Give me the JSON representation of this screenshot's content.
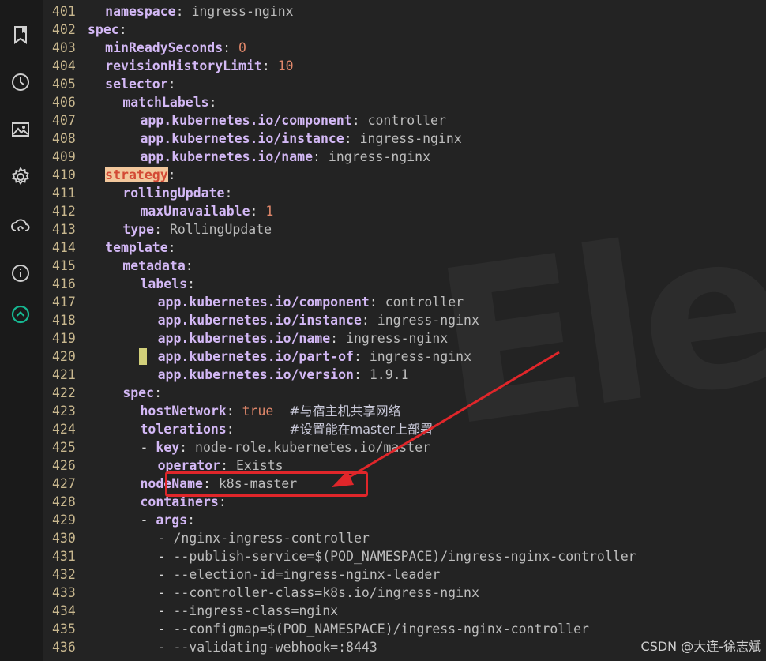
{
  "sidebar": {
    "icons": [
      "bookmark-icon",
      "clock-icon",
      "image-icon",
      "gear-icon",
      "cloud-sync-icon",
      "info-icon",
      "scroll-up-icon"
    ]
  },
  "watermark_text": "Elec",
  "editor": {
    "lines": [
      {
        "n": "401",
        "indent": 1,
        "key": "namespace",
        "val": "ingress-nginx"
      },
      {
        "n": "402",
        "indent": 0,
        "key": "spec"
      },
      {
        "n": "403",
        "indent": 1,
        "key": "minReadySeconds",
        "val": "0",
        "vt": "num"
      },
      {
        "n": "404",
        "indent": 1,
        "key": "revisionHistoryLimit",
        "val": "10",
        "vt": "num"
      },
      {
        "n": "405",
        "indent": 1,
        "key": "selector"
      },
      {
        "n": "406",
        "indent": 2,
        "key": "matchLabels"
      },
      {
        "n": "407",
        "indent": 3,
        "key": "app.kubernetes.io/component",
        "val": "controller"
      },
      {
        "n": "408",
        "indent": 3,
        "key": "app.kubernetes.io/instance",
        "val": "ingress-nginx"
      },
      {
        "n": "409",
        "indent": 3,
        "key": "app.kubernetes.io/name",
        "val": "ingress-nginx"
      },
      {
        "n": "410",
        "indent": 1,
        "key": "strategy",
        "hl": true
      },
      {
        "n": "411",
        "indent": 2,
        "key": "rollingUpdate"
      },
      {
        "n": "412",
        "indent": 3,
        "key": "maxUnavailable",
        "val": "1",
        "vt": "num"
      },
      {
        "n": "413",
        "indent": 2,
        "key": "type",
        "val": "RollingUpdate"
      },
      {
        "n": "414",
        "indent": 1,
        "key": "template"
      },
      {
        "n": "415",
        "indent": 2,
        "key": "metadata"
      },
      {
        "n": "416",
        "indent": 3,
        "key": "labels"
      },
      {
        "n": "417",
        "indent": 4,
        "key": "app.kubernetes.io/component",
        "val": "controller"
      },
      {
        "n": "418",
        "indent": 4,
        "key": "app.kubernetes.io/instance",
        "val": "ingress-nginx"
      },
      {
        "n": "419",
        "indent": 4,
        "key": "app.kubernetes.io/name",
        "val": "ingress-nginx"
      },
      {
        "n": "420",
        "indent": 4,
        "key": "app.kubernetes.io/part-of",
        "val": "ingress-nginx"
      },
      {
        "n": "421",
        "indent": 4,
        "key": "app.kubernetes.io/version",
        "val": "1.9.1"
      },
      {
        "n": "422",
        "indent": 2,
        "key": "spec"
      },
      {
        "n": "423",
        "indent": 3,
        "key": "hostNetwork",
        "val": "true",
        "vt": "bool",
        "pad": "  ",
        "comment": "#与宿主机共享网络"
      },
      {
        "n": "424",
        "indent": 3,
        "key": "tolerations",
        "pad": "       ",
        "comment": "#设置能在master上部署"
      },
      {
        "n": "425",
        "indent": 3,
        "dash": true,
        "key": "key",
        "val": "node-role.kubernetes.io/master"
      },
      {
        "n": "426",
        "indent": 4,
        "key": "operator",
        "val": "Exists"
      },
      {
        "n": "427",
        "indent": 3,
        "key": "nodeName",
        "val": "k8s-master"
      },
      {
        "n": "428",
        "indent": 3,
        "key": "containers"
      },
      {
        "n": "429",
        "indent": 3,
        "dash": true,
        "key": "args"
      },
      {
        "n": "430",
        "indent": 4,
        "dash": true,
        "val": "/nginx-ingress-controller"
      },
      {
        "n": "431",
        "indent": 4,
        "dash": true,
        "val": "--publish-service=$(POD_NAMESPACE)/ingress-nginx-controller"
      },
      {
        "n": "432",
        "indent": 4,
        "dash": true,
        "val": "--election-id=ingress-nginx-leader"
      },
      {
        "n": "433",
        "indent": 4,
        "dash": true,
        "val": "--controller-class=k8s.io/ingress-nginx"
      },
      {
        "n": "434",
        "indent": 4,
        "dash": true,
        "val": "--ingress-class=nginx"
      },
      {
        "n": "435",
        "indent": 4,
        "dash": true,
        "val": "--configmap=$(POD_NAMESPACE)/ingress-nginx-controller"
      },
      {
        "n": "436",
        "indent": 4,
        "dash": true,
        "val": "--validating-webhook=:8443"
      }
    ]
  },
  "colors": {
    "highlight_box": "#e0262a",
    "arrow": "#e0262a"
  },
  "credit": "CSDN @大连-徐志斌"
}
